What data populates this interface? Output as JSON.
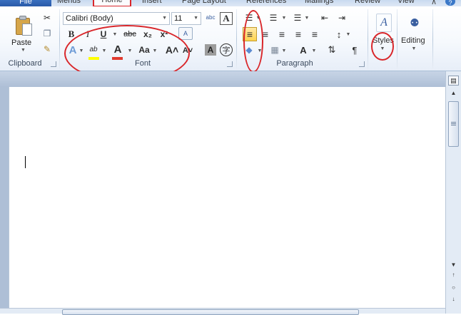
{
  "tabs": {
    "file": "File",
    "menus": "Menus",
    "home": "Home",
    "insert": "Insert",
    "page_layout": "Page Layout",
    "references": "References",
    "mailings": "Mailings",
    "review": "Review",
    "view": "View"
  },
  "window_controls": {
    "minimize_ribbon": "∧",
    "help": "?"
  },
  "clipboard": {
    "paste_label": "Paste",
    "group_label": "Clipboard",
    "cut": "✂",
    "copy": "❐",
    "format_painter": "✎"
  },
  "font": {
    "font_name": "Calibri (Body)",
    "font_size": "11",
    "group_label": "Font",
    "bold": "B",
    "italic": "I",
    "underline": "U",
    "strikethrough": "abc",
    "subscript": "x₂",
    "superscript": "x²",
    "text_effects": "A",
    "highlight": "ab",
    "font_color": "A",
    "change_case": "Aa",
    "grow_font": "A˄",
    "shrink_font": "A˅",
    "clear_formatting": "A",
    "phonetic_guide": "abc",
    "character_border": "A",
    "character_shading": "A",
    "enclose_characters": "字"
  },
  "paragraph": {
    "group_label": "Paragraph",
    "bullets": "☰",
    "numbering": "☰",
    "multilevel": "☰",
    "decrease_indent": "⇤",
    "increase_indent": "⇥",
    "align_left": "≡",
    "center": "≡",
    "align_right": "≡",
    "justify": "≡",
    "distributed": "≡",
    "line_spacing": "↕",
    "shading": "◆",
    "borders": "▦",
    "asian_layout": "A",
    "sort": "⇅",
    "show_marks": "¶"
  },
  "styles": {
    "label": "Styles",
    "icon_glyph": "A"
  },
  "editing": {
    "label": "Editing",
    "icon_glyph": "⚉"
  },
  "scrollbar": {
    "up": "▲",
    "down": "▼",
    "prev_page": "↑",
    "browse_object": "○",
    "next_page": "↓",
    "ruler_toggle": "▤"
  },
  "colors": {
    "highlight": "#ffff00",
    "font_color": "#e03a2f",
    "annotation_red": "#d9262a",
    "file_tab": "#2a5aa8"
  }
}
